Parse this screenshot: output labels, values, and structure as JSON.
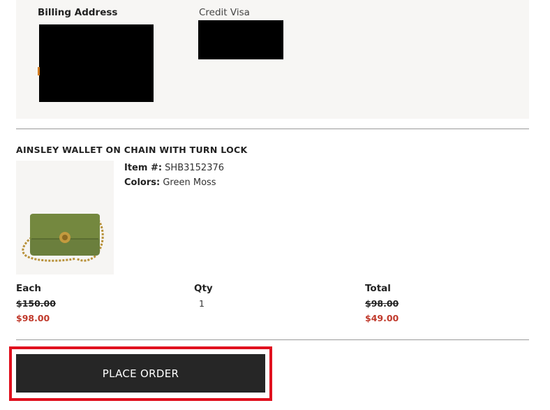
{
  "billing": {
    "title": "Billing Address",
    "payment_method": "Credit Visa"
  },
  "product": {
    "name": "AINSLEY WALLET ON CHAIN WITH TURN LOCK",
    "item_label": "Item #:",
    "item_number": "SHB3152376",
    "color_label": "Colors:",
    "color_value": "Green Moss"
  },
  "pricing": {
    "each_label": "Each",
    "each_original": "$150.00",
    "each_sale": "$98.00",
    "qty_label": "Qty",
    "qty_value": "1",
    "total_label": "Total",
    "total_original": "$98.00",
    "total_sale": "$49.00"
  },
  "actions": {
    "place_order_label": "PLACE ORDER"
  },
  "colors": {
    "sale_price": "#c0392b",
    "button_bg": "#262626",
    "highlight": "#e0101e",
    "product_green": "#6b7f3d"
  }
}
